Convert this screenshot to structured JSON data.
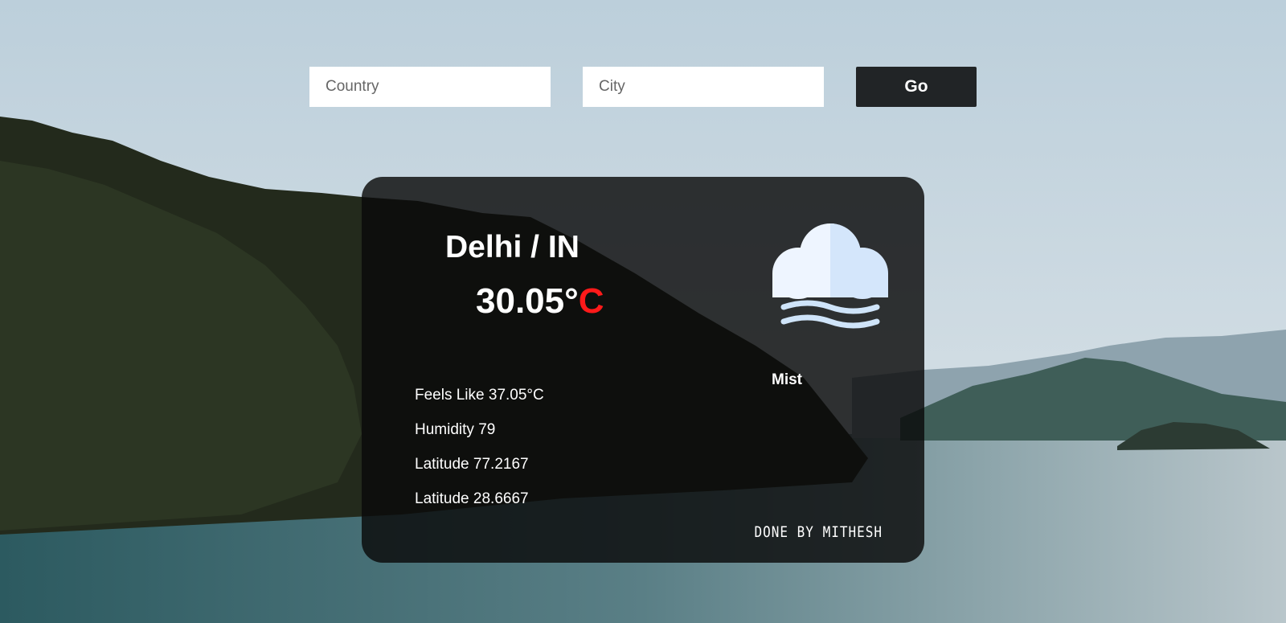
{
  "search": {
    "country_placeholder": "Country",
    "city_placeholder": "City",
    "go_label": "Go"
  },
  "weather": {
    "location": "Delhi / IN",
    "temperature_value": "30.05°",
    "temperature_unit": "C",
    "condition": "Mist",
    "icon": "mist-icon",
    "details": [
      {
        "label": "Feels Like",
        "value": "37.05°C"
      },
      {
        "label": "Humidity",
        "value": "79"
      },
      {
        "label": "Latitude",
        "value": "77.2167"
      },
      {
        "label": "Latitude",
        "value": "28.6667"
      }
    ]
  },
  "footer": {
    "credit": "DONE BY MITHESH"
  },
  "colors": {
    "button_bg": "#212426",
    "unit_accent": "#ff1a1a",
    "card_bg": "rgba(10,10,10,0.82)"
  }
}
